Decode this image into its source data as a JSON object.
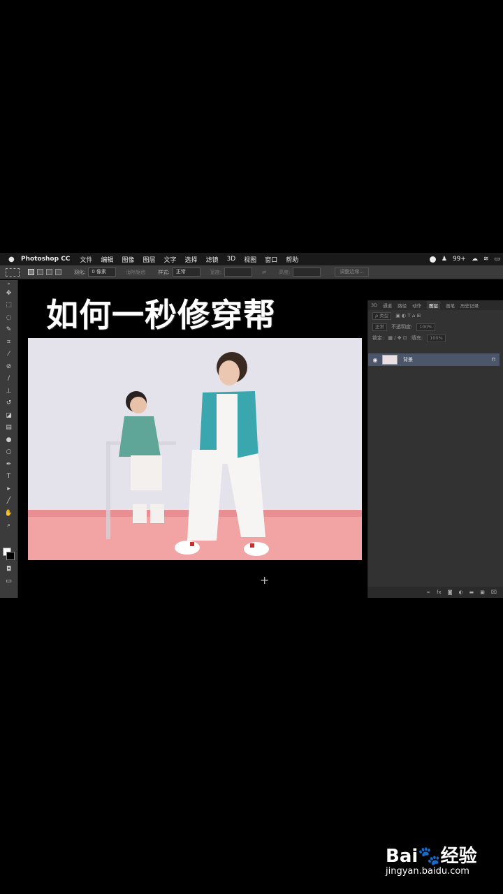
{
  "menubar": {
    "apple": "",
    "app": "Photoshop CC",
    "menus": [
      "文件",
      "编辑",
      "图像",
      "图层",
      "文字",
      "选择",
      "滤镜",
      "3D",
      "视图",
      "窗口",
      "帮助"
    ],
    "notification_count": "99+"
  },
  "options": {
    "feather_label": "羽化:",
    "feather_value": "0 像素",
    "antialias_label": "消除锯齿",
    "style_label": "样式:",
    "style_value": "正常",
    "width_label": "宽度:",
    "height_label": "高度:",
    "refine_edge": "调整边缘..."
  },
  "canvas": {
    "title": "如何一秒修穿帮"
  },
  "layers_panel": {
    "tabs": [
      "3D",
      "通道",
      "路径",
      "动作",
      "图层",
      "画笔",
      "历史记录"
    ],
    "active_tab": "图层",
    "filter_label": "ρ 类型",
    "blend_mode": "正常",
    "opacity_label": "不透明度:",
    "opacity_value": "100%",
    "lock_label": "锁定:",
    "fill_label": "填充:",
    "fill_value": "100%",
    "layers": [
      {
        "name": "背景",
        "visible": true,
        "locked": true
      }
    ]
  },
  "watermark": {
    "logo": "Bai🐾经验",
    "url": "jingyan.baidu.com"
  },
  "colors": {
    "menubar_bg": "#1a1a1a",
    "panel_bg": "#323232",
    "selected_layer": "#4c566a",
    "photo_wall": "#e3e3ea",
    "photo_floor": "#f0a0a2",
    "jacket_teal": "#3aa6ad"
  }
}
